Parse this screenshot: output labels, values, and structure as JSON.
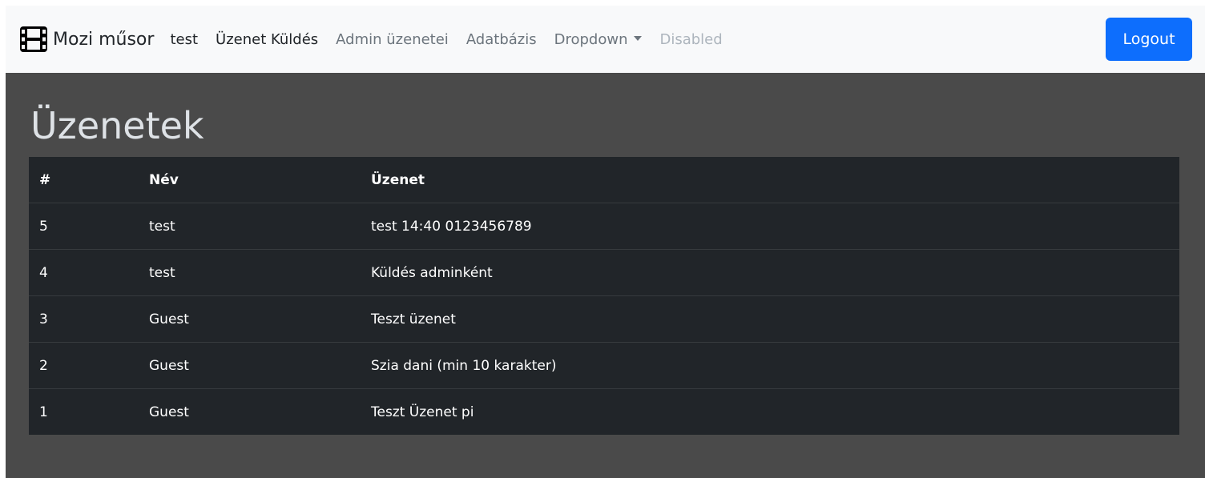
{
  "navbar": {
    "brand": "Mozi műsor",
    "brand_icon": "film-icon",
    "links": [
      {
        "label": "test",
        "state": "active"
      },
      {
        "label": "Üzenet Küldés",
        "state": "active"
      },
      {
        "label": "Admin üzenetei",
        "state": "muted"
      },
      {
        "label": "Adatbázis",
        "state": "muted"
      },
      {
        "label": "Dropdown",
        "state": "muted"
      },
      {
        "label": "Disabled",
        "state": "disabled"
      }
    ],
    "logout_label": "Logout"
  },
  "page": {
    "title": "Üzenetek"
  },
  "table": {
    "headers": [
      "#",
      "Név",
      "Üzenet"
    ],
    "rows": [
      {
        "id": "5",
        "name": "test",
        "message": "test 14:40 0123456789"
      },
      {
        "id": "4",
        "name": "test",
        "message": "Küldés adminként"
      },
      {
        "id": "3",
        "name": "Guest",
        "message": "Teszt üzenet"
      },
      {
        "id": "2",
        "name": "Guest",
        "message": "Szia dani (min 10 karakter)"
      },
      {
        "id": "1",
        "name": "Guest",
        "message": "Teszt Üzenet pi"
      }
    ]
  },
  "colors": {
    "navbar_bg": "#f8f9fa",
    "page_bg": "#4a4a4a",
    "table_bg": "#212529",
    "primary": "#0d6efd"
  }
}
